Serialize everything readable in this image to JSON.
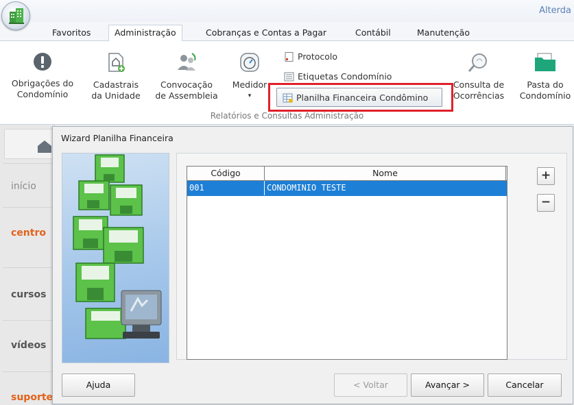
{
  "app": {
    "title": "Alterda"
  },
  "tabs": [
    "Favoritos",
    "Administração",
    "Cobranças e Contas a Pagar",
    "Contábil",
    "Manutenção"
  ],
  "ribbon": {
    "buttons": [
      {
        "line1": "Obrigações do",
        "line2": "Condomínio",
        "icon": "exclamation-icon"
      },
      {
        "line1": "Cadastrais",
        "line2": "da Unidade",
        "icon": "house-document-icon"
      },
      {
        "line1": "Convocação",
        "line2": "de Assembleia",
        "icon": "people-call-icon"
      },
      {
        "line1": "Medidor",
        "line2": "▾",
        "icon": "gauge-icon"
      },
      {
        "line1": "Consulta de",
        "line2": "Ocorrências",
        "icon": "search-icon"
      },
      {
        "line1": "Pasta do",
        "line2": "Condomínio",
        "icon": "folder-icon"
      }
    ],
    "small_buttons": [
      "Protocolo",
      "Etiquetas Condomínio",
      "Planilha Financeira Condômino"
    ],
    "group_label": "Relatórios e Consultas Administração"
  },
  "left_nav": [
    "início",
    "centro",
    "cursos",
    "vídeos",
    "suporte"
  ],
  "wizard": {
    "title": "Wizard Planilha Financeira",
    "columns": [
      "Código",
      "Nome"
    ],
    "rows": [
      {
        "codigo": "001",
        "nome": "CONDOMINIO TESTE"
      }
    ],
    "add_label": "+",
    "remove_label": "−",
    "buttons": {
      "help": "Ajuda",
      "back": "< Voltar",
      "next": "Avançar >",
      "cancel": "Cancelar"
    }
  },
  "colors": {
    "selection": "#1e7fd6",
    "highlight": "#e0202a",
    "accent_orange": "#e2621b"
  }
}
